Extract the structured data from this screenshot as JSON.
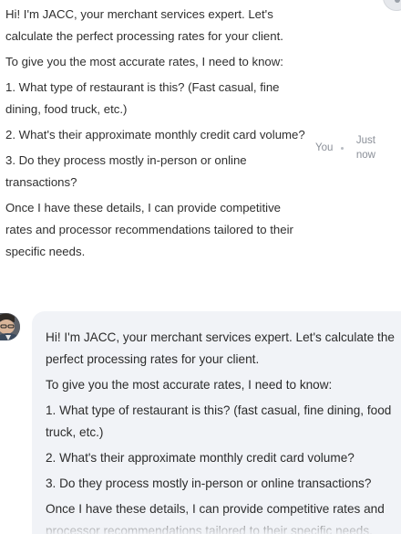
{
  "first_message": {
    "paragraphs": [
      "Hi! I'm JACC, your merchant services expert. Let's calculate the perfect processing rates for your client.",
      "To give you the most accurate rates, I need to know:",
      "1. What type of restaurant is this? (Fast casual, fine dining, food truck, etc.)",
      "2. What's their approximate monthly credit card volume?",
      "3. Do they process mostly in-person or online transactions?",
      "Once I have these details, I can provide competitive rates and processor recommendations tailored to their specific needs."
    ],
    "sender": "You",
    "timestamp_line1": "Just",
    "timestamp_line2": "now"
  },
  "assistant_message": {
    "avatar_icon": "bot-avatar-icon",
    "paragraphs": [
      "Hi! I'm JACC, your merchant services expert. Let's calculate the perfect processing rates for your client.",
      "To give you the most accurate rates, I need to know:",
      "1. What type of restaurant is this? (fast casual, fine dining, food truck, etc.)",
      "2. What's their approximate monthly credit card volume?",
      "3. Do they process mostly in-person or online transactions?",
      "Once I have these details, I can provide competitive rates and processor recommendations tailored to their specific needs."
    ]
  },
  "colors": {
    "bubble_bg": "#f1f3f7",
    "meta_text": "#8a8f98",
    "body_text": "#2b2b2b"
  }
}
